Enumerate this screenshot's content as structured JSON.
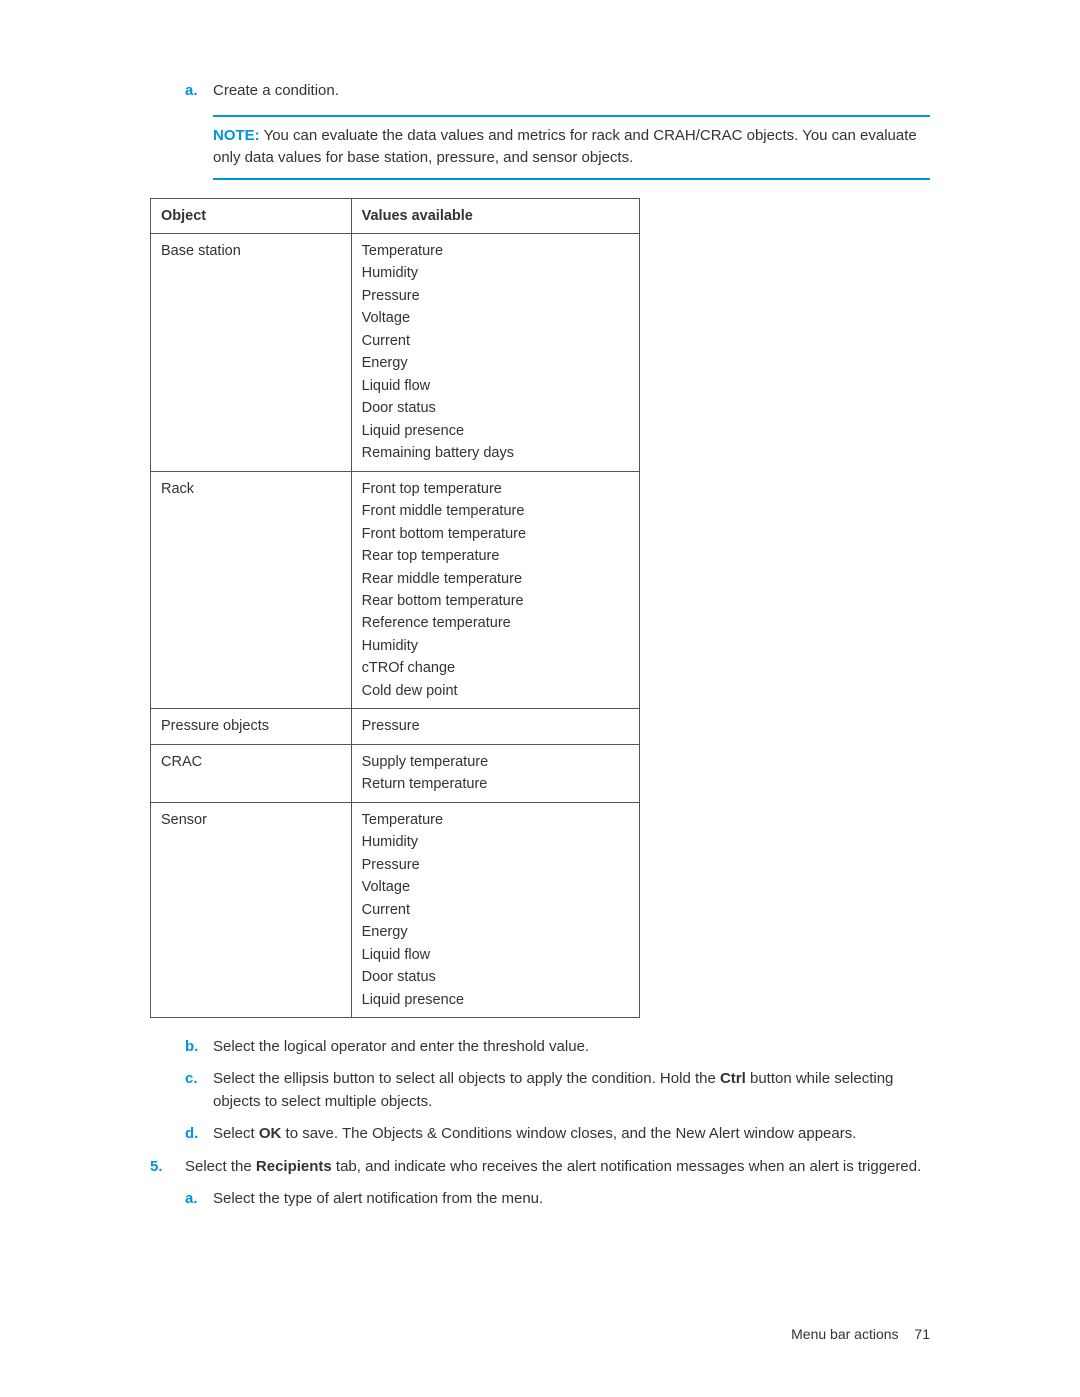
{
  "steps_top": {
    "a": {
      "marker": "a.",
      "text": "Create a condition."
    }
  },
  "note": {
    "label": "NOTE:",
    "text": "You can evaluate the data values and metrics for rack and CRAH/CRAC objects. You can evaluate only data values for base station, pressure, and sensor objects."
  },
  "table": {
    "headers": {
      "object": "Object",
      "values": "Values available"
    },
    "rows": [
      {
        "object": "Base station",
        "values": [
          "Temperature",
          "Humidity",
          "Pressure",
          "Voltage",
          "Current",
          "Energy",
          "Liquid flow",
          "Door status",
          "Liquid presence",
          "Remaining battery days"
        ]
      },
      {
        "object": "Rack",
        "values": [
          "Front top temperature",
          "Front middle temperature",
          "Front bottom temperature",
          "Rear top temperature",
          "Rear middle temperature",
          "Rear bottom temperature",
          "Reference temperature",
          "Humidity",
          "cTROf change",
          "Cold dew point"
        ]
      },
      {
        "object": "Pressure objects",
        "values": [
          "Pressure"
        ]
      },
      {
        "object": "CRAC",
        "values": [
          "Supply temperature",
          "Return temperature"
        ]
      },
      {
        "object": "Sensor",
        "values": [
          "Temperature",
          "Humidity",
          "Pressure",
          "Voltage",
          "Current",
          "Energy",
          "Liquid flow",
          "Door status",
          "Liquid presence"
        ]
      }
    ]
  },
  "steps_after": {
    "b": {
      "marker": "b.",
      "text": "Select the logical operator and enter the threshold value."
    },
    "c": {
      "marker": "c.",
      "prefix": "Select the ellipsis button to select all objects to apply the condition. Hold the ",
      "bold": "Ctrl",
      "suffix": " button while selecting objects to select multiple objects."
    },
    "d": {
      "marker": "d.",
      "prefix": "Select ",
      "bold": "OK",
      "suffix": " to save. The Objects & Conditions window closes, and the New Alert window appears."
    }
  },
  "step5": {
    "marker": "5.",
    "prefix": "Select the ",
    "bold": "Recipients",
    "suffix": " tab, and indicate who receives the alert notification messages when an alert is triggered.",
    "sub_a": {
      "marker": "a.",
      "text": "Select the type of alert notification from the menu."
    }
  },
  "footer": {
    "section": "Menu bar actions",
    "page": "71"
  }
}
